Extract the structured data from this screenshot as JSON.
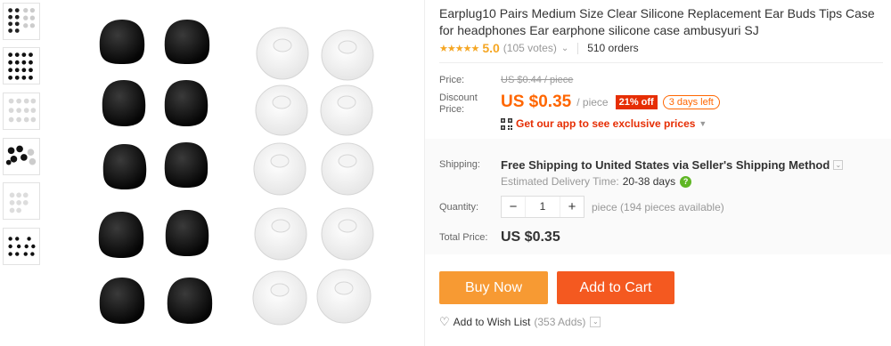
{
  "thumbnails": [
    {
      "name": "thumb-grey-dots"
    },
    {
      "name": "thumb-black-dots"
    },
    {
      "name": "thumb-clear-dots"
    },
    {
      "name": "thumb-mixed-tips"
    },
    {
      "name": "thumb-clear-small"
    },
    {
      "name": "thumb-black-small"
    }
  ],
  "product": {
    "title": "Earplug10 Pairs Medium Size Clear Silicone Replacement Ear Buds Tips Case for headphones Ear earphone silicone case ambusyuri SJ",
    "stars": "★★★★★",
    "rating": "5.0",
    "votes": "(105 votes)",
    "orders": "510 orders"
  },
  "pricing": {
    "price_label": "Price:",
    "old_price": "US $0.44 / piece",
    "discount_label_1": "Discount",
    "discount_label_2": "Price:",
    "price": "US $0.35",
    "per_piece": "/ piece",
    "discount_badge": "21% off",
    "days_left": "3 days left",
    "app_promo": "Get our app to see exclusive prices"
  },
  "shipping": {
    "label": "Shipping:",
    "text": "Free Shipping to United States via Seller's Shipping Method",
    "delivery_label": "Estimated Delivery Time:",
    "delivery_value": "20-38 days"
  },
  "quantity": {
    "label": "Quantity:",
    "value": "1",
    "minus": "−",
    "plus": "+",
    "available": "piece (194 pieces available)"
  },
  "total": {
    "label": "Total Price:",
    "value": "US $0.35"
  },
  "actions": {
    "buy_now": "Buy Now",
    "add_to_cart": "Add to Cart",
    "wishlist": "Add to Wish List",
    "wishlist_count": "(353 Adds)"
  },
  "colors": {
    "price_orange": "#ff6600",
    "discount_red": "#e62e04",
    "buy_now": "#f79a33",
    "add_to_cart": "#f45920",
    "star": "#f5a623"
  }
}
